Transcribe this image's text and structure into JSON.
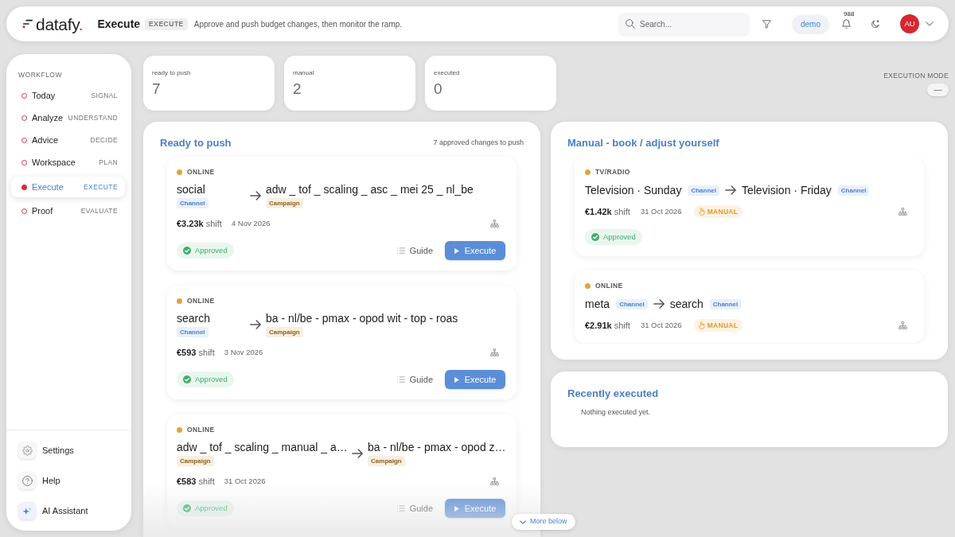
{
  "header": {
    "logo": {
      "word": "datafy",
      "dot": "."
    },
    "page_title": "Execute",
    "page_stage": "EXECUTE",
    "description": "Approve and push budget changes, then monitor the ramp.",
    "search": {
      "placeholder": "Search..."
    },
    "workspace": "demo",
    "notification_count": "988",
    "avatar_initials": "AU"
  },
  "sidebar": {
    "section_label": "WORKFLOW",
    "items": [
      {
        "label": "Today",
        "stage": "SIGNAL",
        "selected": false
      },
      {
        "label": "Analyze",
        "stage": "UNDERSTAND",
        "selected": false
      },
      {
        "label": "Advice",
        "stage": "DECIDE",
        "selected": false
      },
      {
        "label": "Workspace",
        "stage": "PLAN",
        "selected": false
      },
      {
        "label": "Execute",
        "stage": "EXECUTE",
        "selected": true
      },
      {
        "label": "Proof",
        "stage": "EVALUATE",
        "selected": false
      }
    ],
    "footer_items": [
      {
        "kind": "settings",
        "label": "Settings"
      },
      {
        "kind": "help",
        "label": "Help"
      },
      {
        "kind": "assistant",
        "label": "AI Assistant"
      }
    ]
  },
  "stats": [
    {
      "label": "ready to push",
      "value": "7"
    },
    {
      "label": "manual",
      "value": "2"
    },
    {
      "label": "executed",
      "value": "0"
    }
  ],
  "execution_mode": {
    "label": "EXECUTION MODE",
    "value": "—"
  },
  "ready_to_push": {
    "title": "Ready to push",
    "summary": "7 approved changes to push",
    "items": [
      {
        "category": "ONLINE",
        "from": {
          "name": "social",
          "type": "Channel",
          "kind": "channel"
        },
        "to": {
          "name": "adw _ tof _ scaling _ asc _ mei 25 _ nl_be",
          "type": "Campaign",
          "kind": "campaign"
        },
        "shift": "**€3.23k** shift",
        "date": "4 Nov 2026",
        "status": "Approved",
        "guide_label": "Guide",
        "execute_label": "Execute"
      },
      {
        "category": "ONLINE",
        "from": {
          "name": "search",
          "type": "Channel",
          "kind": "channel"
        },
        "to": {
          "name": "ba - nl/be - pmax - opod wit - top - roas",
          "type": "Campaign",
          "kind": "campaign"
        },
        "shift": "**€593** shift",
        "date": "3 Nov 2026",
        "status": "Approved",
        "guide_label": "Guide",
        "execute_label": "Execute"
      },
      {
        "category": "ONLINE",
        "from": {
          "name": "adw _ tof _ scaling _ manual _ a…",
          "type": "Campaign",
          "kind": "campaign"
        },
        "to": {
          "name": "ba - nl/be - pmax - opod z…",
          "type": "Campaign",
          "kind": "campaign"
        },
        "shift": "**€583** shift",
        "date": "31 Oct 2026",
        "status": "Approved",
        "guide_label": "Guide",
        "execute_label": "Execute"
      }
    ],
    "more_button": "More below"
  },
  "manual": {
    "title": "Manual - book / adjust yourself",
    "items": [
      {
        "category": "TV/RADIO",
        "from": {
          "name": "Television · Sunday",
          "type": "Channel",
          "kind": "channel"
        },
        "to": {
          "name": "Television · Friday",
          "type": "Channel",
          "kind": "channel"
        },
        "shift": "**€1.42k** shift",
        "date": "31 Oct 2026",
        "mode": "MANUAL",
        "status": "Approved"
      },
      {
        "category": "ONLINE",
        "from": {
          "name": "meta",
          "type": "Channel",
          "kind": "channel"
        },
        "to": {
          "name": "search",
          "type": "Channel",
          "kind": "channel"
        },
        "shift": "**€2.91k** shift",
        "date": "31 Oct 2026",
        "mode": "MANUAL"
      }
    ]
  },
  "recently_executed": {
    "title": "Recently executed",
    "empty_text": "Nothing executed yet."
  }
}
